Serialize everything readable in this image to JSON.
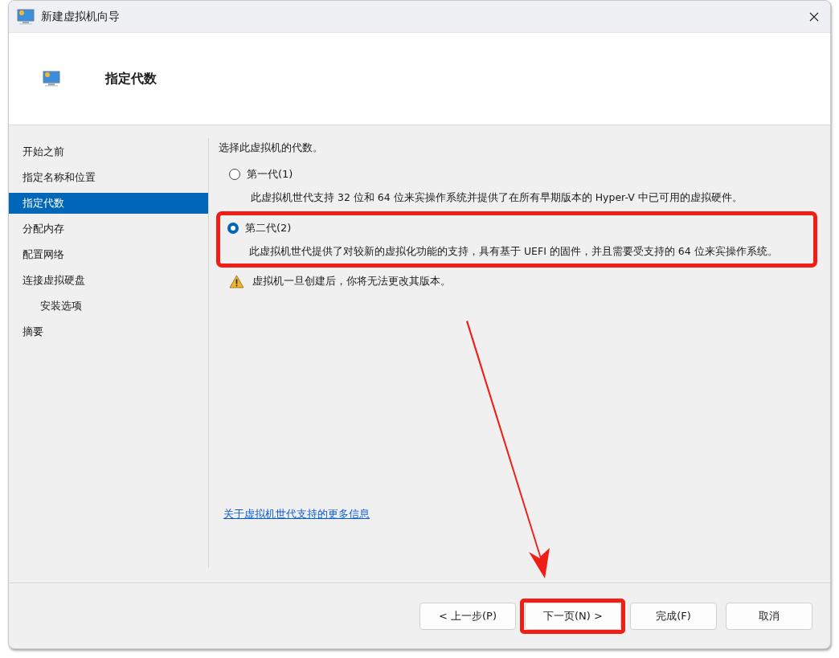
{
  "window": {
    "title": "新建虚拟机向导"
  },
  "header": {
    "title": "指定代数"
  },
  "sidebar": {
    "items": [
      {
        "label": "开始之前",
        "selected": false
      },
      {
        "label": "指定名称和位置",
        "selected": false
      },
      {
        "label": "指定代数",
        "selected": true
      },
      {
        "label": "分配内存",
        "selected": false
      },
      {
        "label": "配置网络",
        "selected": false
      },
      {
        "label": "连接虚拟硬盘",
        "selected": false,
        "children": [
          {
            "label": "安装选项",
            "selected": false
          }
        ]
      },
      {
        "label": "摘要",
        "selected": false
      }
    ]
  },
  "content": {
    "prompt": "选择此虚拟机的代数。",
    "options": [
      {
        "label": "第一代(1)",
        "selected": false,
        "highlighted": false,
        "description": "此虚拟机世代支持 32 位和 64 位来宾操作系统并提供了在所有早期版本的 Hyper-V 中已可用的虚拟硬件。"
      },
      {
        "label": "第二代(2)",
        "selected": true,
        "highlighted": true,
        "description": "此虚拟机世代提供了对较新的虚拟化功能的支持，具有基于 UEFI 的固件，并且需要受支持的 64 位来宾操作系统。"
      }
    ],
    "warning": "虚拟机一旦创建后，你将无法更改其版本。",
    "link": "关于虚拟机世代支持的更多信息"
  },
  "buttons": [
    {
      "label": "< 上一步(P)",
      "highlighted": false
    },
    {
      "label": "下一页(N) >",
      "highlighted": true
    },
    {
      "label": "完成(F)",
      "highlighted": false
    },
    {
      "label": "取消",
      "highlighted": false
    }
  ]
}
